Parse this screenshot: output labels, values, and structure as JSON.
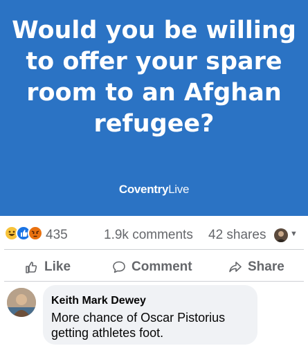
{
  "post": {
    "headline_lines": [
      "Would you be willing",
      "to offer your spare",
      "room to an Afghan",
      "refugee?"
    ],
    "brand": {
      "part1": "Coventry",
      "part2": "Live"
    },
    "background_color": "#2b73c4"
  },
  "stats": {
    "reactions": [
      "haha",
      "like",
      "angry"
    ],
    "reaction_count": "435",
    "comments": "1.9k comments",
    "shares": "42 shares"
  },
  "actions": {
    "like": "Like",
    "comment": "Comment",
    "share": "Share"
  },
  "comment": {
    "author": "Keith Mark Dewey",
    "text": "More chance of Oscar Pistorius getting athletes foot."
  }
}
